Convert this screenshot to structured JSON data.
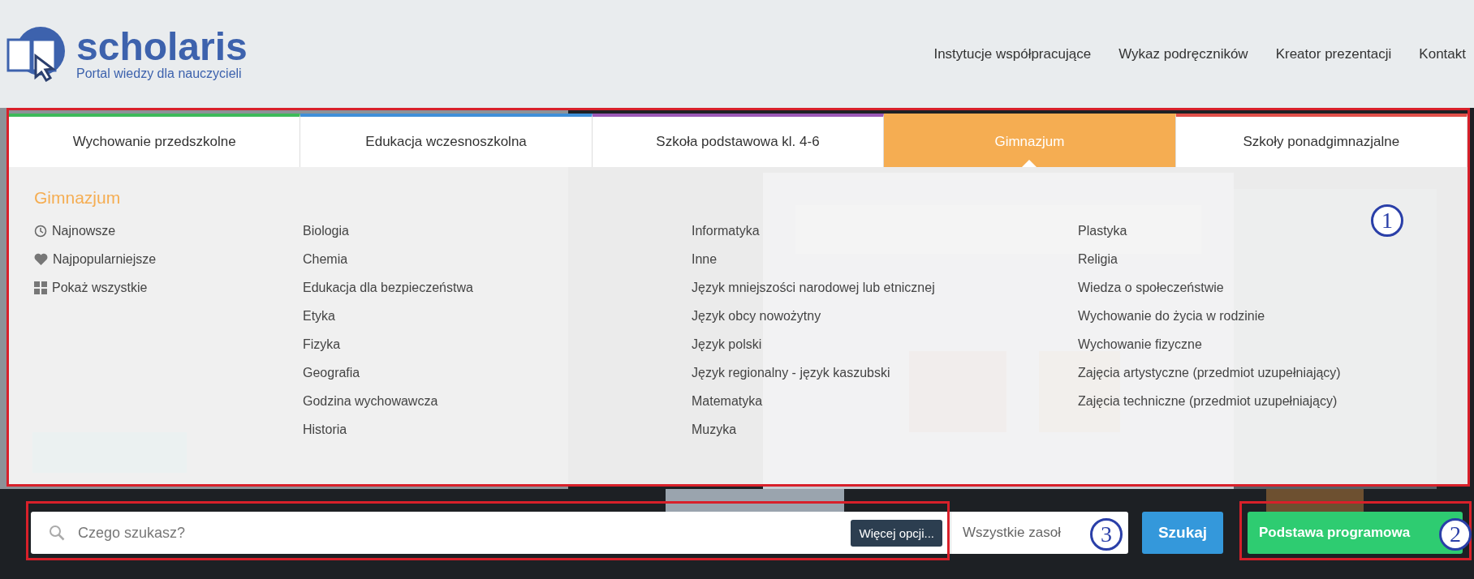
{
  "header": {
    "logo": {
      "name": "scholaris",
      "tagline": "Portal wiedzy dla nauczycieli"
    },
    "nav": [
      "Instytucje współpracujące",
      "Wykaz podręczników",
      "Kreator prezentacji",
      "Kontakt"
    ]
  },
  "tabs": [
    {
      "label": "Wychowanie przedszkolne",
      "color": "#3dba5a",
      "selected": false
    },
    {
      "label": "Edukacja wczesnoszkolna",
      "color": "#3f8fd8",
      "selected": false
    },
    {
      "label": "Szkoła podstawowa kl. 4-6",
      "color": "#9b59b6",
      "selected": false
    },
    {
      "label": "Gimnazjum",
      "color": "#f5ad52",
      "selected": true
    },
    {
      "label": "Szkoły ponadgimnazjalne",
      "color": "#e0504a",
      "selected": false
    }
  ],
  "panel": {
    "title": "Gimnazjum",
    "quick_links": [
      {
        "kind": "clock",
        "label": "Najnowsze"
      },
      {
        "kind": "heart",
        "label": "Najpopularniejsze"
      },
      {
        "kind": "grid",
        "label": "Pokaż wszystkie"
      }
    ],
    "subject_columns": [
      [
        "Biologia",
        "Chemia",
        "Edukacja dla bezpieczeństwa",
        "Etyka",
        "Fizyka",
        "Geografia",
        "Godzina wychowawcza",
        "Historia"
      ],
      [
        "Informatyka",
        "Inne",
        "Język mniejszości narodowej lub etnicznej",
        "Język obcy nowożytny",
        "Język polski",
        "Język regionalny - język kaszubski",
        "Matematyka",
        "Muzyka"
      ],
      [
        "Plastyka",
        "Religia",
        "Wiedza o społeczeństwie",
        "Wychowanie do życia w rodzinie",
        "Wychowanie fizyczne",
        "Zajęcia artystyczne (przedmiot uzupełniający)",
        "Zajęcia techniczne (przedmiot uzupełniający)"
      ]
    ]
  },
  "search": {
    "placeholder": "Czego szukasz?",
    "options_button": "Więcej opcji...",
    "scope": "Wszystkie zasoł",
    "submit": "Szukaj"
  },
  "curriculum_button": "Podstawa programowa",
  "annotations": [
    {
      "number": "1"
    },
    {
      "number": "3"
    },
    {
      "number": "2"
    }
  ]
}
